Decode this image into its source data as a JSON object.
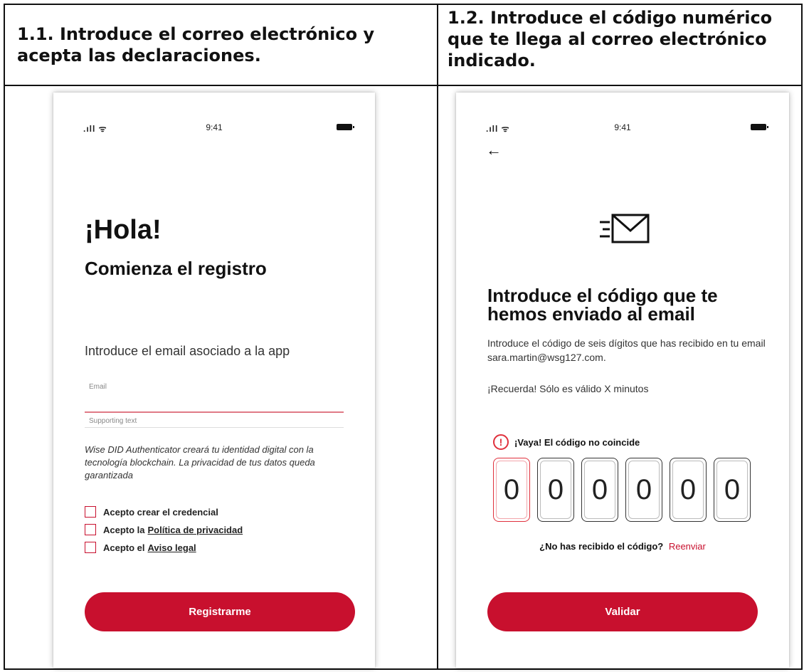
{
  "headers": {
    "left": "1.1. Introduce el correo electrónico y acepta las declaraciones.",
    "right": "1.2. Introduce el código numérico que te llega al correo electrónico indicado."
  },
  "status_bar": {
    "signal": ".ıll ᯤ",
    "time": "9:41"
  },
  "register_screen": {
    "greeting": "¡Hola!",
    "subtitle": "Comienza el registro",
    "intro": "Introduce el email asociado a la app",
    "email_label": "Email",
    "email_value": "",
    "supporting_text": "Supporting text",
    "disclaimer": "Wise DID Authenticator creará tu identidad digital con la tecnología blockchain. La privacidad de tus datos queda garantizada",
    "checks": [
      {
        "prefix": "Acepto crear el credencial",
        "link": ""
      },
      {
        "prefix": "Acepto la",
        "link": "Política de privacidad"
      },
      {
        "prefix": "Acepto el",
        "link": "Aviso legal"
      }
    ],
    "button": "Registrarme"
  },
  "code_screen": {
    "back_icon": "arrow-left-icon",
    "title": "Introduce el código que te hemos enviado al email",
    "description": "Introduce el código de seis dígitos que has recibido  en tu email sara.martin@wsg127.com.",
    "reminder": "¡Recuerda! Sólo es válido X minutos",
    "error": "¡Vaya! El código no coincide",
    "digits": [
      "0",
      "0",
      "0",
      "0",
      "0",
      "0"
    ],
    "resend_question": "¿No has recibido el código?",
    "resend_link": "Reenviar",
    "button": "Validar"
  },
  "colors": {
    "brand_red": "#c8102e",
    "error_red": "#e0303c"
  }
}
